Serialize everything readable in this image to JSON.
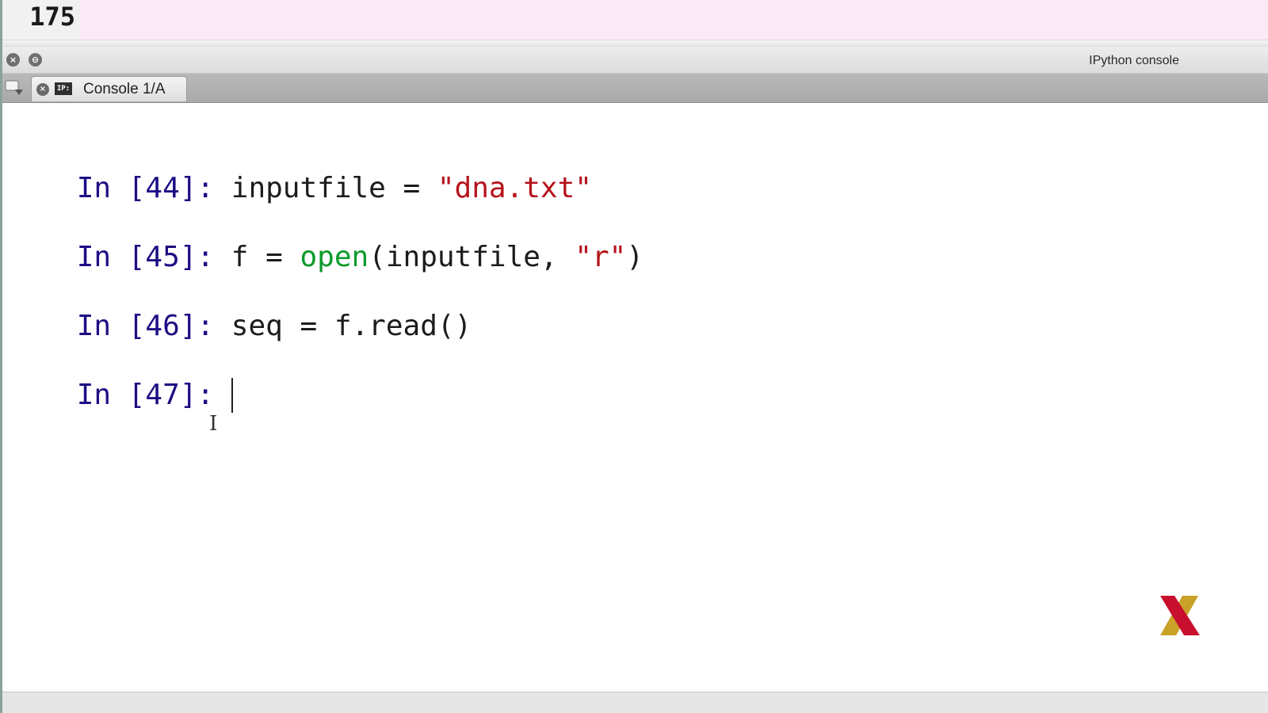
{
  "editor": {
    "line_number": "175"
  },
  "pane": {
    "title": "IPython console",
    "close_glyph": "×",
    "undock_glyph": "⊖"
  },
  "tabs": [
    {
      "label": "Console 1/A",
      "icon_text": "IP:",
      "close_glyph": "×"
    }
  ],
  "console": {
    "entries": [
      {
        "prompt": "In [44]:",
        "code": [
          {
            "text": "inputfile = ",
            "kind": "plain"
          },
          {
            "text": "\"dna.txt\"",
            "kind": "string"
          }
        ]
      },
      {
        "prompt": "In [45]:",
        "code": [
          {
            "text": "f = ",
            "kind": "plain"
          },
          {
            "text": "open",
            "kind": "builtin"
          },
          {
            "text": "(inputfile, ",
            "kind": "plain"
          },
          {
            "text": "\"r\"",
            "kind": "string"
          },
          {
            "text": ")",
            "kind": "plain"
          }
        ]
      },
      {
        "prompt": "In [46]:",
        "code": [
          {
            "text": "seq = f.read()",
            "kind": "plain"
          }
        ]
      },
      {
        "prompt": "In [47]:",
        "code": []
      }
    ]
  },
  "colors": {
    "prompt": "#1d0e84",
    "string": "#b5121b",
    "builtin": "#0c9a2a",
    "editor_highlight": "#fbe9f6",
    "logo_red": "#c8102e",
    "logo_gold": "#c9a227"
  },
  "icons": {
    "mouse_cursor": "text-ibeam-cursor-icon",
    "logo": "edx-logo-icon",
    "tab_options": "tab-options-icon"
  }
}
